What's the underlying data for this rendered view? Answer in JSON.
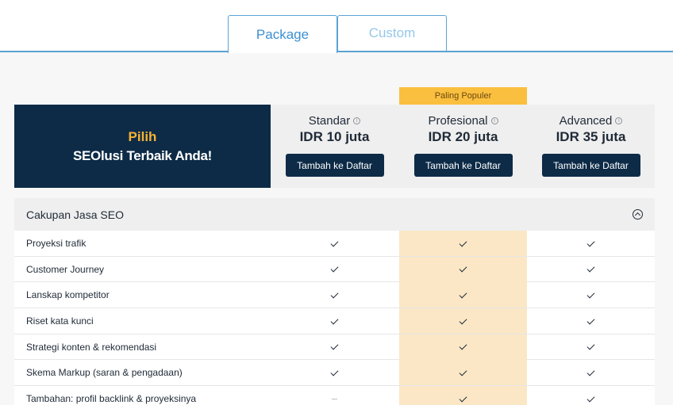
{
  "tabs": [
    {
      "label": "Package",
      "active": true
    },
    {
      "label": "Custom",
      "active": false
    }
  ],
  "hero": {
    "pick": "Pilih",
    "title": "SEOlusi Terbaik Anda!"
  },
  "popular_badge": "Paling Populer",
  "plans": [
    {
      "name": "Standar",
      "price": "IDR 10 juta",
      "button": "Tambah ke Daftar"
    },
    {
      "name": "Profesional",
      "price": "IDR 20 juta",
      "button": "Tambah ke Daftar"
    },
    {
      "name": "Advanced",
      "price": "IDR 35 juta",
      "button": "Tambah ke Daftar"
    }
  ],
  "section": {
    "title": "Cakupan Jasa SEO",
    "icon": "chevron-up-circle-icon"
  },
  "features": [
    {
      "label": "Proyeksi trafik",
      "values": [
        "check",
        "check",
        "check"
      ]
    },
    {
      "label": "Customer Journey",
      "values": [
        "check",
        "check",
        "check"
      ]
    },
    {
      "label": "Lanskap kompetitor",
      "values": [
        "check",
        "check",
        "check"
      ]
    },
    {
      "label": "Riset kata kunci",
      "values": [
        "check",
        "check",
        "check"
      ]
    },
    {
      "label": "Strategi konten & rekomendasi",
      "values": [
        "check",
        "check",
        "check"
      ]
    },
    {
      "label": "Skema Markup (saran & pengadaan)",
      "values": [
        "check",
        "check",
        "check"
      ]
    },
    {
      "label": "Tambahan: profil backlink & proyeksinya",
      "values": [
        "dash",
        "check",
        "check"
      ]
    }
  ],
  "colors": {
    "navy": "#0d2b47",
    "accent_blue": "#3d8fcf",
    "badge_yellow": "#fbbf3f",
    "highlight": "#fbe7c6"
  }
}
